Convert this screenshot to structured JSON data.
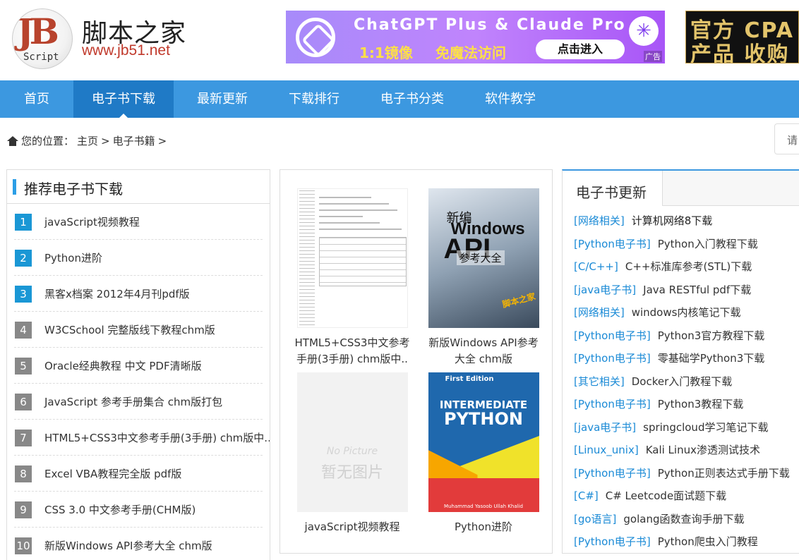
{
  "header": {
    "logo_mark_letters": "JB",
    "logo_mark_caption": "Script",
    "site_name": "脚本之家",
    "site_url": "www.jb51.net",
    "ad_main": {
      "title": "ChatGPT Plus & Claude Pro",
      "subtitle_a": "1:1镜像",
      "subtitle_b": "免魔法访问",
      "button": "点击进入",
      "tag": "广告"
    },
    "ad_side": {
      "line1": "官方 CPA",
      "line2": "产品 收购"
    }
  },
  "nav": {
    "items": [
      {
        "label": "首页"
      },
      {
        "label": "电子书下载"
      },
      {
        "label": "最新更新"
      },
      {
        "label": "下载排行"
      },
      {
        "label": "电子书分类"
      },
      {
        "label": "软件教学"
      }
    ],
    "active_index": 1
  },
  "breadcrumb": {
    "prefix": "您的位置：",
    "home": "主页",
    "sep": ">",
    "current": "电子书籍",
    "search_placeholder": "请"
  },
  "recommend": {
    "title": "推荐电子书下载",
    "items": [
      {
        "rank": "1",
        "title": "javaScript视频教程"
      },
      {
        "rank": "2",
        "title": "Python进阶"
      },
      {
        "rank": "3",
        "title": "黑客x档案 2012年4月刊pdf版"
      },
      {
        "rank": "4",
        "title": "W3CSchool 完整版线下教程chm版"
      },
      {
        "rank": "5",
        "title": "Oracle经典教程 中文 PDF清晰版"
      },
      {
        "rank": "6",
        "title": "JavaScript 参考手册集合 chm版打包"
      },
      {
        "rank": "7",
        "title": "HTML5+CSS3中文参考手册(3手册) chm版中..."
      },
      {
        "rank": "8",
        "title": "Excel VBA教程完全版 pdf版"
      },
      {
        "rank": "9",
        "title": "CSS 3.0 中文参考手册(CHM版)"
      },
      {
        "rank": "10",
        "title": "新版Windows API参考大全 chm版"
      }
    ]
  },
  "books": [
    {
      "title": "HTML5+CSS3中文参考手册(3手册) chm版中..",
      "cover": "html5-manual"
    },
    {
      "title": "新版Windows API参考大全 chm版",
      "cover": "windows-api",
      "cover_text": {
        "l1": "新编",
        "l2": "Windows",
        "l3": "API",
        "l4": "参考大全",
        "badge": "脚本之家"
      }
    },
    {
      "title": "javaScript视频教程",
      "cover": "no-picture",
      "cover_text": {
        "l1": "No Picture",
        "l2": "暂无图片"
      }
    },
    {
      "title": "Python进阶",
      "cover": "intermediate-python",
      "cover_text": {
        "first": "First Edition",
        "l1": "INTERMEDIATE",
        "l2": "PYTHON",
        "author": "Muhammad Yasoob Ullah Khalid"
      }
    }
  ],
  "updates": {
    "title": "电子书更新",
    "items": [
      {
        "cat": "[网络相关]",
        "title": "计算机网络8下载"
      },
      {
        "cat": "[Python电子书]",
        "title": "Python入门教程下载"
      },
      {
        "cat": "[C/C++]",
        "title": "C++标准库参考(STL)下载"
      },
      {
        "cat": "[java电子书]",
        "title": "Java RESTful pdf下载"
      },
      {
        "cat": "[网络相关]",
        "title": "windows内核笔记下载"
      },
      {
        "cat": "[Python电子书]",
        "title": "Python3官方教程下载"
      },
      {
        "cat": "[Python电子书]",
        "title": "零基础学Python3下载"
      },
      {
        "cat": "[其它相关]",
        "title": "Docker入门教程下载"
      },
      {
        "cat": "[Python电子书]",
        "title": "Python3教程下载"
      },
      {
        "cat": "[java电子书]",
        "title": "springcloud学习笔记下载"
      },
      {
        "cat": "[Linux_unix]",
        "title": "Kali Linux渗透测试技术"
      },
      {
        "cat": "[Python电子书]",
        "title": "Python正则表达式手册下载"
      },
      {
        "cat": "[C#]",
        "title": "C# Leetcode面试题下载"
      },
      {
        "cat": "[go语言]",
        "title": "golang函数查询手册下载"
      },
      {
        "cat": "[Python电子书]",
        "title": "Python爬虫入门教程"
      }
    ]
  },
  "colors": {
    "nav_bg": "#3c98e0",
    "nav_active": "#1f7ac6",
    "rank_top": "#1a97d5",
    "rank_other": "#888888",
    "category_link": "#1a8ad6"
  }
}
